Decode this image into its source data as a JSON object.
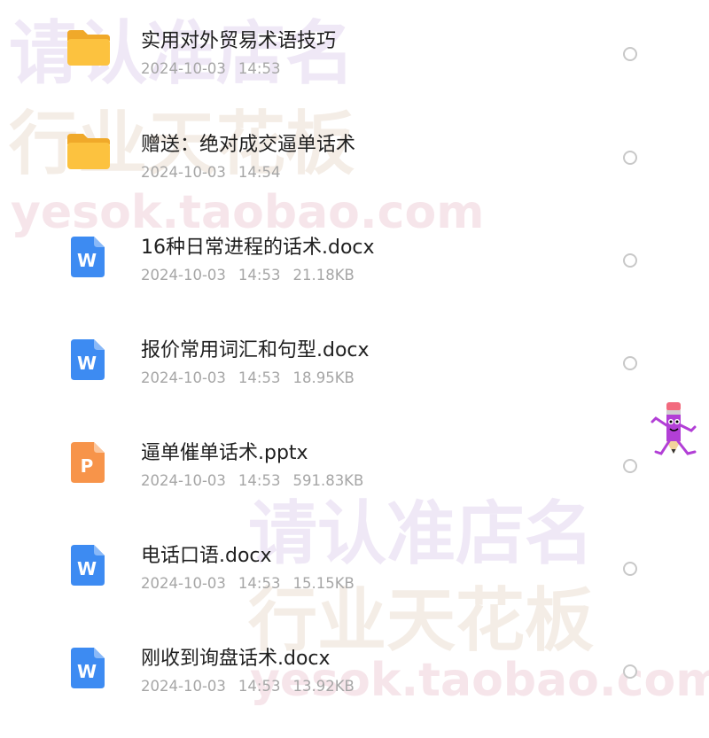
{
  "watermarks": {
    "top_line1": "请认准店名",
    "top_line2": "行业天花板",
    "top_url": "yesok.taobao.com",
    "bottom_line1": "请认准店名",
    "bottom_line2": "行业天花板",
    "bottom_url": "yesok.taobao.com"
  },
  "files": [
    {
      "type": "folder",
      "icon": "folder-icon",
      "name": "实用对外贸易术语技巧",
      "date": "2024-10-03",
      "time": "14:53",
      "size": ""
    },
    {
      "type": "folder",
      "icon": "folder-icon",
      "name": "赠送：绝对成交逼单话术",
      "date": "2024-10-03",
      "time": "14:54",
      "size": ""
    },
    {
      "type": "docx",
      "icon": "word-doc-icon",
      "letter": "W",
      "color": "#3d8bf2",
      "name": "16种日常进程的话术.docx",
      "date": "2024-10-03",
      "time": "14:53",
      "size": "21.18KB"
    },
    {
      "type": "docx",
      "icon": "word-doc-icon",
      "letter": "W",
      "color": "#3d8bf2",
      "name": "报价常用词汇和句型.docx",
      "date": "2024-10-03",
      "time": "14:53",
      "size": "18.95KB"
    },
    {
      "type": "pptx",
      "icon": "ppt-doc-icon",
      "letter": "P",
      "color": "#f7944a",
      "name": "逼单催单话术.pptx",
      "date": "2024-10-03",
      "time": "14:53",
      "size": "591.83KB"
    },
    {
      "type": "docx",
      "icon": "word-doc-icon",
      "letter": "W",
      "color": "#3d8bf2",
      "name": "电话口语.docx",
      "date": "2024-10-03",
      "time": "14:53",
      "size": "15.15KB"
    },
    {
      "type": "docx",
      "icon": "word-doc-icon",
      "letter": "W",
      "color": "#3d8bf2",
      "name": "刚收到询盘话术.docx",
      "date": "2024-10-03",
      "time": "14:53",
      "size": "13.92KB"
    }
  ],
  "colors": {
    "folder": "#fcc23f",
    "word": "#3d8bf2",
    "ppt": "#f7944a",
    "mascot": "#b23fd6"
  }
}
